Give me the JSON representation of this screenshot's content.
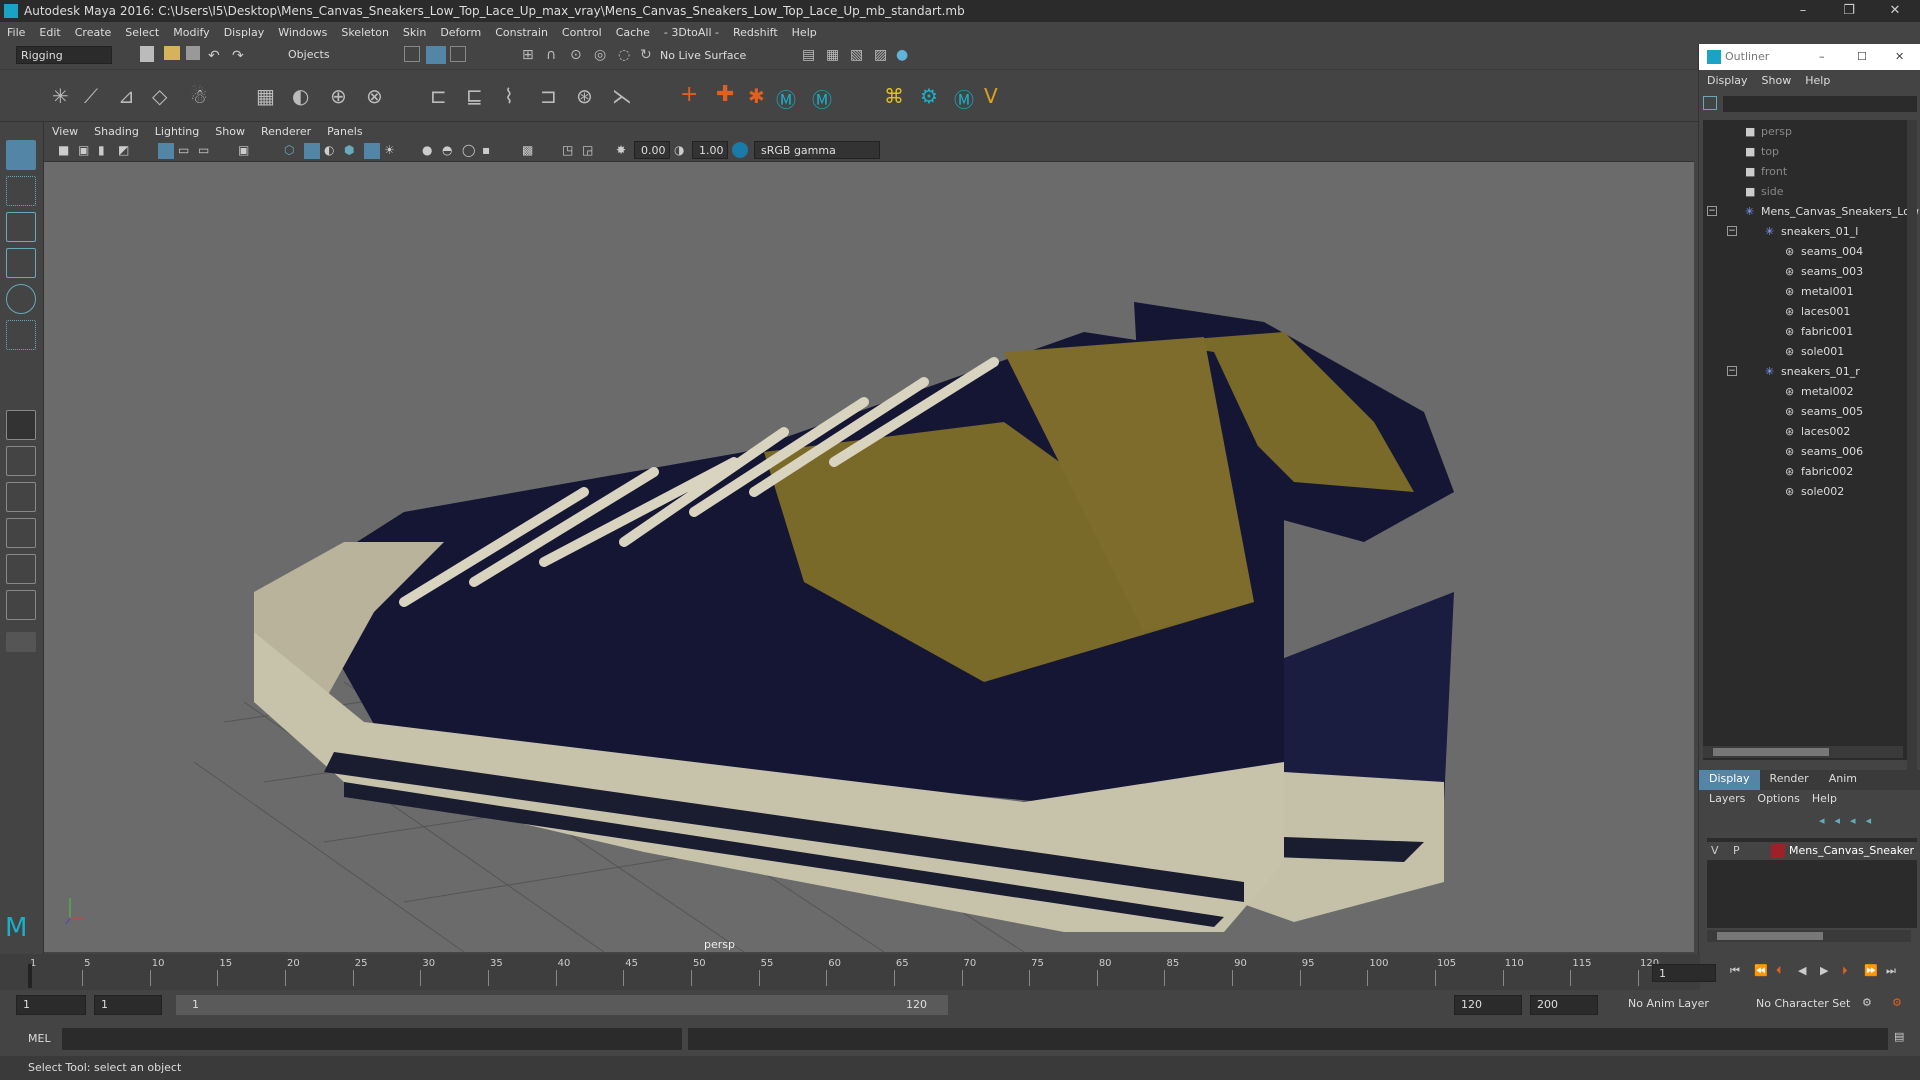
{
  "window": {
    "title": "Autodesk Maya 2016: C:\\Users\\I5\\Desktop\\Mens_Canvas_Sneakers_Low_Top_Lace_Up_max_vray\\Mens_Canvas_Sneakers_Low_Top_Lace_Up_mb_standart.mb",
    "minimize": "–",
    "maximize": "❐",
    "close": "✕"
  },
  "menubar": [
    "File",
    "Edit",
    "Create",
    "Select",
    "Modify",
    "Display",
    "Windows",
    "Skeleton",
    "Skin",
    "Deform",
    "Constrain",
    "Control",
    "Cache",
    "- 3DtoAll -",
    "Redshift",
    "Help"
  ],
  "statusline": {
    "mode": "Rigging",
    "selection_mask": "Objects",
    "live_surface": "No Live Surface"
  },
  "viewport": {
    "menu": [
      "View",
      "Shading",
      "Lighting",
      "Show",
      "Renderer",
      "Panels"
    ],
    "exposure": "0.00",
    "gamma": "1.00",
    "color_space": "sRGB gamma",
    "camera_label": "persp"
  },
  "outliner": {
    "title": "Outliner",
    "menu": [
      "Display",
      "Show",
      "Help"
    ],
    "items": [
      {
        "label": "persp",
        "indent": 0,
        "type": "camera",
        "dim": true
      },
      {
        "label": "top",
        "indent": 0,
        "type": "camera",
        "dim": true
      },
      {
        "label": "front",
        "indent": 0,
        "type": "camera",
        "dim": true
      },
      {
        "label": "side",
        "indent": 0,
        "type": "camera",
        "dim": true
      },
      {
        "label": "Mens_Canvas_Sneakers_Low",
        "indent": 0,
        "type": "group",
        "expand": true
      },
      {
        "label": "sneakers_01_l",
        "indent": 1,
        "type": "group",
        "expand": true
      },
      {
        "label": "seams_004",
        "indent": 2,
        "type": "mesh"
      },
      {
        "label": "seams_003",
        "indent": 2,
        "type": "mesh"
      },
      {
        "label": "metal001",
        "indent": 2,
        "type": "mesh"
      },
      {
        "label": "laces001",
        "indent": 2,
        "type": "mesh"
      },
      {
        "label": "fabric001",
        "indent": 2,
        "type": "mesh"
      },
      {
        "label": "sole001",
        "indent": 2,
        "type": "mesh"
      },
      {
        "label": "sneakers_01_r",
        "indent": 1,
        "type": "group",
        "expand": true
      },
      {
        "label": "metal002",
        "indent": 2,
        "type": "mesh"
      },
      {
        "label": "seams_005",
        "indent": 2,
        "type": "mesh"
      },
      {
        "label": "laces002",
        "indent": 2,
        "type": "mesh"
      },
      {
        "label": "seams_006",
        "indent": 2,
        "type": "mesh"
      },
      {
        "label": "fabric002",
        "indent": 2,
        "type": "mesh"
      },
      {
        "label": "sole002",
        "indent": 2,
        "type": "mesh"
      }
    ]
  },
  "layers": {
    "tabs": [
      "Display",
      "Render",
      "Anim"
    ],
    "menu": [
      "Layers",
      "Options",
      "Help"
    ],
    "row": {
      "v": "V",
      "p": "P",
      "name": "Mens_Canvas_Sneaker",
      "color": "#a0202a"
    }
  },
  "timeline": {
    "ticks": [
      "1",
      "5",
      "10",
      "15",
      "20",
      "25",
      "30",
      "35",
      "40",
      "45",
      "50",
      "55",
      "60",
      "65",
      "70",
      "75",
      "80",
      "85",
      "90",
      "95",
      "100",
      "105",
      "110",
      "115",
      "120"
    ],
    "current_frame": "1"
  },
  "range": {
    "start": "1",
    "playback_start": "1",
    "slider_start": "1",
    "slider_end": "120",
    "playback_end": "120",
    "end": "200",
    "anim_layer": "No Anim Layer",
    "character_set": "No Character Set"
  },
  "cmdline": {
    "label": "MEL"
  },
  "helpline": "Select Tool: select an object",
  "colors": {
    "bg": "#444444",
    "viewport": "#6b6b6b",
    "accent": "#5fb4d8",
    "selected_tool": "#5285a6"
  }
}
